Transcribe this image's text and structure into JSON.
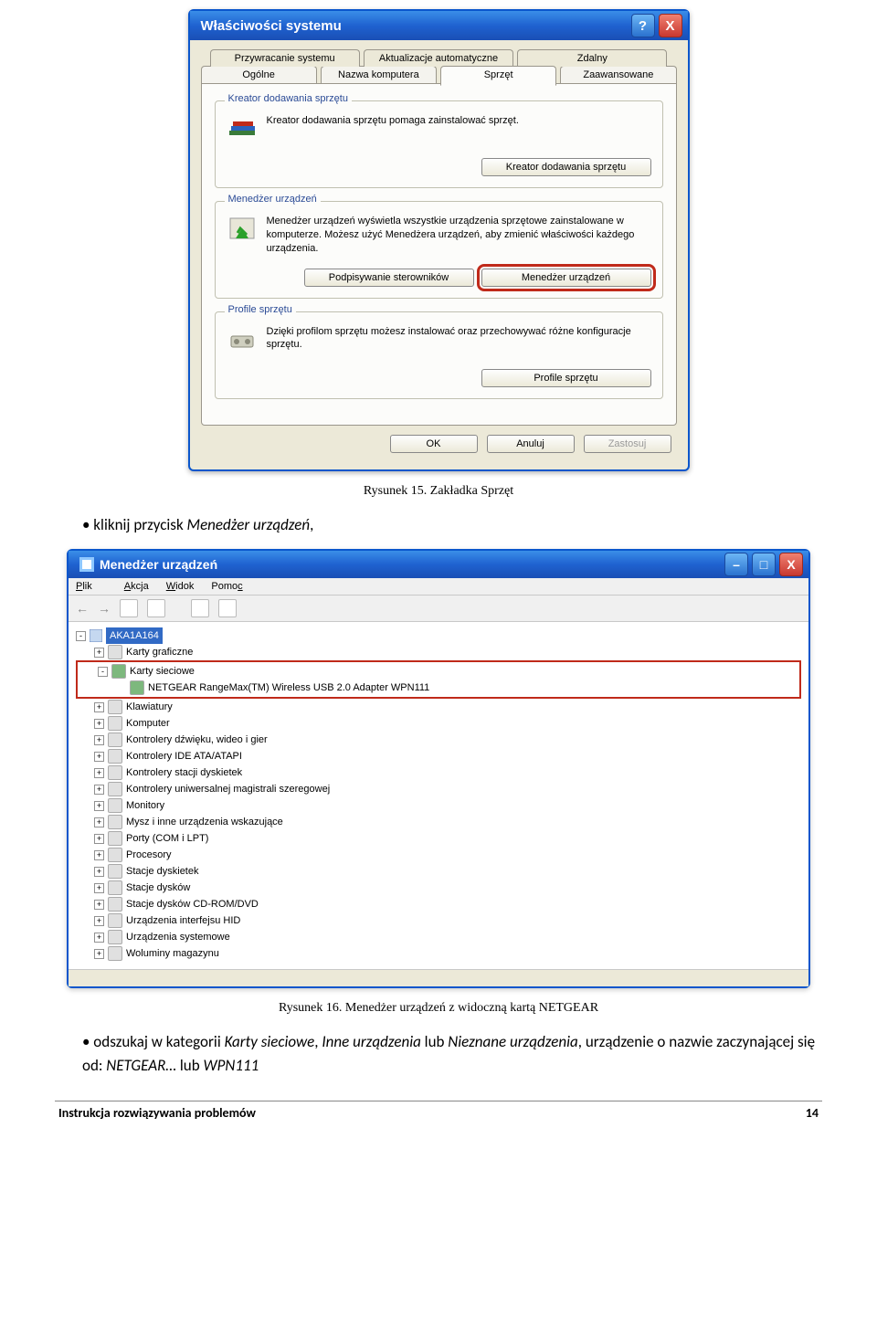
{
  "dialog1": {
    "title": "Właściwości systemu",
    "tabs_back": [
      "Przywracanie systemu",
      "Aktualizacje automatyczne",
      "Zdalny"
    ],
    "tabs_front": [
      "Ogólne",
      "Nazwa komputera",
      "Sprzęt",
      "Zaawansowane"
    ],
    "active_tab": "Sprzęt",
    "group1": {
      "legend": "Kreator dodawania sprzętu",
      "text": "Kreator dodawania sprzętu pomaga zainstalować sprzęt.",
      "button": "Kreator dodawania sprzętu"
    },
    "group2": {
      "legend": "Menedżer urządzeń",
      "text": "Menedżer urządzeń wyświetla wszystkie urządzenia sprzętowe zainstalowane w komputerze. Możesz użyć Menedżera urządzeń, aby zmienić właściwości każdego urządzenia.",
      "button1": "Podpisywanie sterowników",
      "button2": "Menedżer urządzeń"
    },
    "group3": {
      "legend": "Profile sprzętu",
      "text": "Dzięki profilom sprzętu możesz instalować oraz przechowywać różne konfiguracje sprzętu.",
      "button": "Profile sprzętu"
    },
    "actions": {
      "ok": "OK",
      "cancel": "Anuluj",
      "apply": "Zastosuj"
    },
    "help": "?",
    "close": "X"
  },
  "caption1": "Rysunek 15. Zakładka Sprzęt",
  "bullet1_pre": "• kliknij przycisk ",
  "bullet1_em": "Menedżer urządzeń",
  "bullet1_post": ",",
  "dm": {
    "title": "Menedżer urządzeń",
    "menu": {
      "plik": "Plik",
      "akcja": "Akcja",
      "widok": "Widok",
      "pomoc": "Pomoc"
    },
    "root": "AKA1A164",
    "items": [
      "Karty graficzne",
      "Karty sieciowe",
      "NETGEAR RangeMax(TM) Wireless USB 2.0 Adapter WPN111",
      "Klawiatury",
      "Komputer",
      "Kontrolery dźwięku, wideo i gier",
      "Kontrolery IDE ATA/ATAPI",
      "Kontrolery stacji dyskietek",
      "Kontrolery uniwersalnej magistrali szeregowej",
      "Monitory",
      "Mysz i inne urządzenia wskazujące",
      "Porty (COM i LPT)",
      "Procesory",
      "Stacje dyskietek",
      "Stacje dysków",
      "Stacje dysków CD-ROM/DVD",
      "Urządzenia interfejsu HID",
      "Urządzenia systemowe",
      "Woluminy magazynu"
    ]
  },
  "caption2": "Rysunek 16. Menedżer urządzeń z widoczną kartą NETGEAR",
  "bullet2_pre": "• odszukaj w kategorii ",
  "bullet2_em1": "Karty sieciowe",
  "bullet2_mid1": ", ",
  "bullet2_em2": "Inne urządzenia",
  "bullet2_mid2": " lub ",
  "bullet2_em3": "Nieznane urządzenia",
  "bullet2_mid3": ", urządzenie o nazwie zaczynającej się od: ",
  "bullet2_em4": "NETGEAR…",
  "bullet2_mid4": " lub ",
  "bullet2_em5": "WPN111",
  "footer": {
    "left": "Instrukcja rozwiązywania problemów",
    "right": "14"
  }
}
